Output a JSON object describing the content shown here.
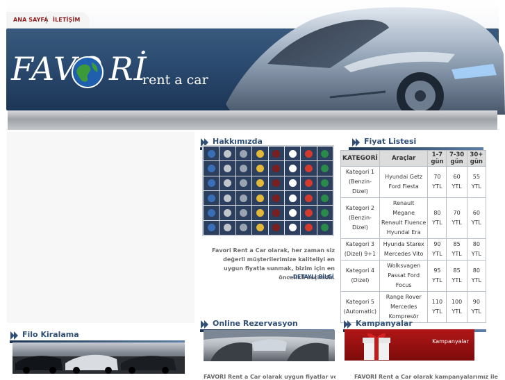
{
  "nav": {
    "home_label": "ANA SAYFA",
    "contact_label": "İLETİŞİM"
  },
  "logo": {
    "part1": "FAVO",
    "part2": "Rİ",
    "tagline": "rent a car"
  },
  "about": {
    "title": "Hakkımızda",
    "text": "Favori Rent a Car olarak, her zaman siz değerli müşterilerimize kaliteliyi en uygun fiyatla sunmak, bizim için en öncelikli seçimdir.",
    "more_label": "DETAYLI BİLGİ"
  },
  "price_list": {
    "title": "Fiyat Listesi",
    "headers": [
      "KATEGORİ",
      "Araçlar",
      "1-7 gün",
      "7-30 gün",
      "30+ gün"
    ],
    "rows": [
      {
        "category": "Kategori 1 (Benzin-Dizel)",
        "cars": "Hyundai Getz Ford Fiesta",
        "p1": "70 YTL",
        "p2": "60 YTL",
        "p3": "55 YTL"
      },
      {
        "category": "Kategori 2 (Benzin-Dizel)",
        "cars": "Renault Megane Renault Fluence Hyundai Era",
        "p1": "80 YTL",
        "p2": "70 YTL",
        "p3": "60 YTL"
      },
      {
        "category": "Kategori 3 (Dizel) 9+1",
        "cars": "Hyunda Starex Mercedes Vito",
        "p1": "90 YTL",
        "p2": "85 YTL",
        "p3": "80 YTL"
      },
      {
        "category": "Kategori 4 (Dizel)",
        "cars": "Wolksvagen Passat Ford Focus",
        "p1": "95 YTL",
        "p2": "85 YTL",
        "p3": "80 YTL"
      },
      {
        "category": "Kategori 5 (Automatic)",
        "cars": "Range Rover Mercedes Kompresör",
        "p1": "110 YTL",
        "p2": "100 YTL",
        "p3": "90 YTL"
      }
    ]
  },
  "fleet": {
    "title": "Filo Kiralama"
  },
  "reservation": {
    "title": "Online Rezervasyon",
    "text": "FAVORİ Rent a Car olarak uygun fiyatlar ve"
  },
  "campaigns": {
    "title": "Kampanyalar",
    "banner_label": "Kampanyalar",
    "text": "FAVORİ Rent a Car olarak kampanyalarımız ile"
  },
  "colors": {
    "header_band": "#2b4a6f",
    "section_title": "#2f4f76",
    "nav_text": "#8a1e1e",
    "campaign_red": "#b01616"
  }
}
